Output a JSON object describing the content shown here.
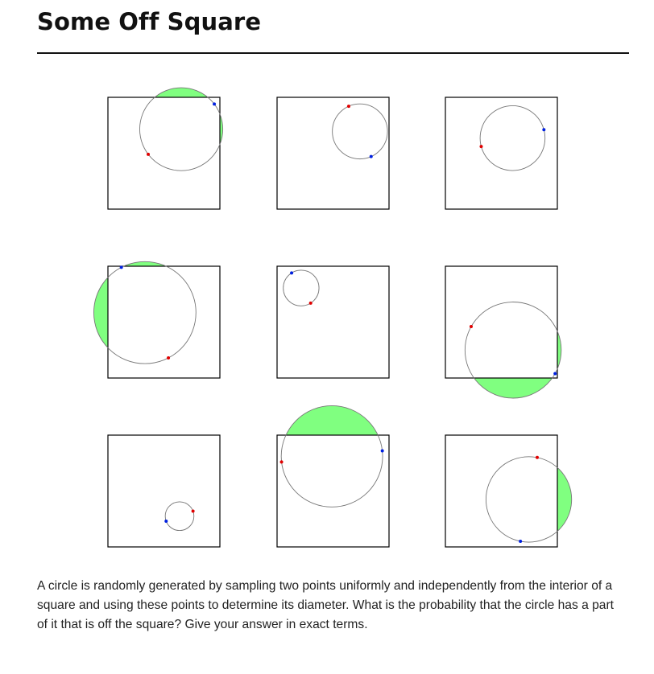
{
  "title": "Some Off Square",
  "problem_text": "A circle is randomly generated by sampling two points uniformly and independently from the interior of a square and using these points to determine its diameter. What is the probability that the circle has a part of it that is off the square? Give your answer in exact terms.",
  "colors": {
    "square_stroke": "#000000",
    "circle_stroke": "#777777",
    "off_square_fill": "#80ff80",
    "point_a": "#e00000",
    "point_b": "#0020e0"
  },
  "examples": [
    {
      "row": 0,
      "col": 0,
      "red": [
        0.36,
        0.49
      ],
      "blue": [
        0.95,
        0.94
      ]
    },
    {
      "row": 0,
      "col": 1,
      "red": [
        0.64,
        0.92
      ],
      "blue": [
        0.84,
        0.47
      ]
    },
    {
      "row": 0,
      "col": 2,
      "red": [
        0.32,
        0.56
      ],
      "blue": [
        0.88,
        0.71
      ]
    },
    {
      "row": 1,
      "col": 0,
      "red": [
        0.54,
        0.18
      ],
      "blue": [
        0.12,
        0.99
      ]
    },
    {
      "row": 1,
      "col": 1,
      "red": [
        0.3,
        0.67
      ],
      "blue": [
        0.13,
        0.94
      ]
    },
    {
      "row": 1,
      "col": 2,
      "red": [
        0.23,
        0.46
      ],
      "blue": [
        0.98,
        0.04
      ]
    },
    {
      "row": 2,
      "col": 0,
      "red": [
        0.76,
        0.32
      ],
      "blue": [
        0.52,
        0.23
      ]
    },
    {
      "row": 2,
      "col": 1,
      "red": [
        0.04,
        0.76
      ],
      "blue": [
        0.94,
        0.86
      ]
    },
    {
      "row": 2,
      "col": 2,
      "red": [
        0.82,
        0.8
      ],
      "blue": [
        0.67,
        0.05
      ]
    }
  ]
}
